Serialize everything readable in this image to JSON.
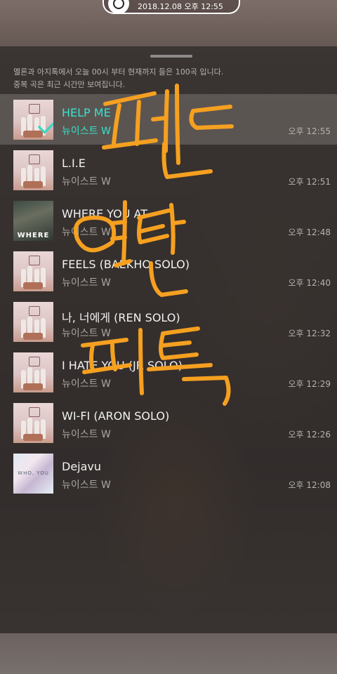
{
  "status": {
    "datetime": "2018.12.08 오후 12:55"
  },
  "info": {
    "line1": "멜론과 아지톡에서 오늘 00시 부터 현재까지 들은 100곡 입니다.",
    "line2": "중복 곡은 최근 시간만 보여집니다."
  },
  "songs": [
    {
      "title": "HELP ME",
      "artist": "뉴이스트 W",
      "time": "오후 12:55",
      "art": "pink",
      "playing": true
    },
    {
      "title": "L.I.E",
      "artist": "뉴이스트 W",
      "time": "오후 12:51",
      "art": "pink"
    },
    {
      "title": "WHERE YOU AT",
      "artist": "뉴이스트 W",
      "time": "오후 12:48",
      "art": "where",
      "art_text": "WHERE"
    },
    {
      "title": "FEELS (BAEKHO SOLO)",
      "artist": "뉴이스트 W",
      "time": "오후 12:40",
      "art": "pink"
    },
    {
      "title": "나, 너에게 (REN SOLO)",
      "artist": "뉴이스트 W",
      "time": "오후 12:32",
      "art": "pink"
    },
    {
      "title": "I HATE YOU (JR SOLO)",
      "artist": "뉴이스트 W",
      "time": "오후 12:29",
      "art": "pink"
    },
    {
      "title": "WI-FI (ARON SOLO)",
      "artist": "뉴이스트 W",
      "time": "오후 12:26",
      "art": "pink"
    },
    {
      "title": "Dejavu",
      "artist": "뉴이스트 W",
      "time": "오후 12:08",
      "art": "dejavu",
      "art_text": "WHO, YOU"
    }
  ],
  "colors": {
    "accent": "#34e3cc",
    "handwriting": "#f5a020"
  }
}
